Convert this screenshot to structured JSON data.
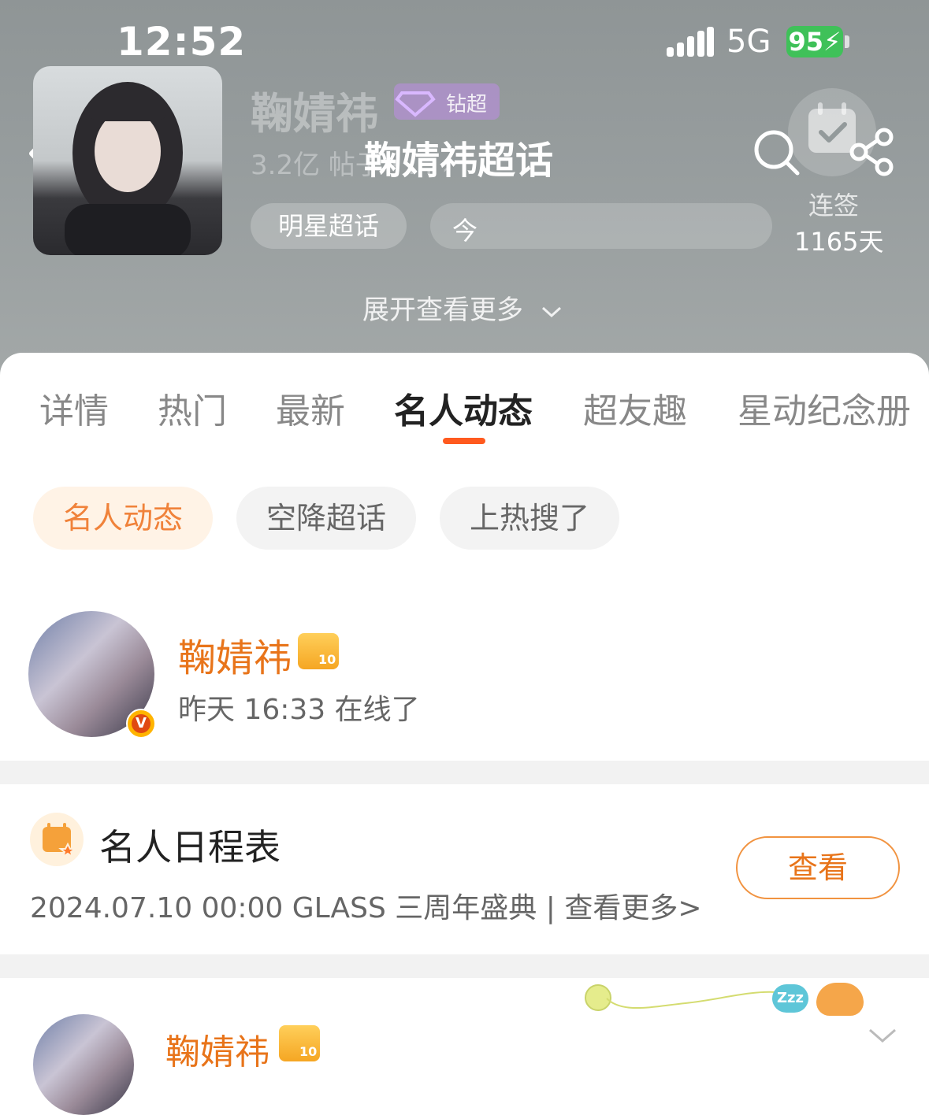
{
  "status_bar": {
    "time": "12:52",
    "network": "5G",
    "battery": "95"
  },
  "header": {
    "title": "鞠婧祎超话",
    "name": "鞠婧祎",
    "badge_label": "钻超",
    "stats": "3.2亿 帖子 · ... ›",
    "category": "明星超话",
    "notice_prefix": "今",
    "checkin_label": "连签",
    "checkin_days": "1165天",
    "expand_more": "展开查看更多"
  },
  "tabs": [
    {
      "label": "详情"
    },
    {
      "label": "热门"
    },
    {
      "label": "最新"
    },
    {
      "label": "名人动态"
    },
    {
      "label": "超友趣"
    },
    {
      "label": "星动纪念册"
    }
  ],
  "active_tab_index": 3,
  "filter_chips": [
    {
      "label": "名人动态"
    },
    {
      "label": "空降超话"
    },
    {
      "label": "上热搜了"
    }
  ],
  "celebrity": {
    "name": "鞠婧祎",
    "verified_mark": "V",
    "crown_level": "10",
    "status": "昨天 16:33 在线了"
  },
  "schedule": {
    "title": "名人日程表",
    "detail": "2024.07.10 00:00 GLASS 三周年盛典 |  查看更多>",
    "button": "查看"
  },
  "post": {
    "name": "鞠婧祎",
    "crown_level": "10",
    "sleep_bubble": "Zzz"
  },
  "colors": {
    "accent": "#e8741a",
    "tab_indicator": "#ff5a1f",
    "battery": "#3fc159"
  }
}
